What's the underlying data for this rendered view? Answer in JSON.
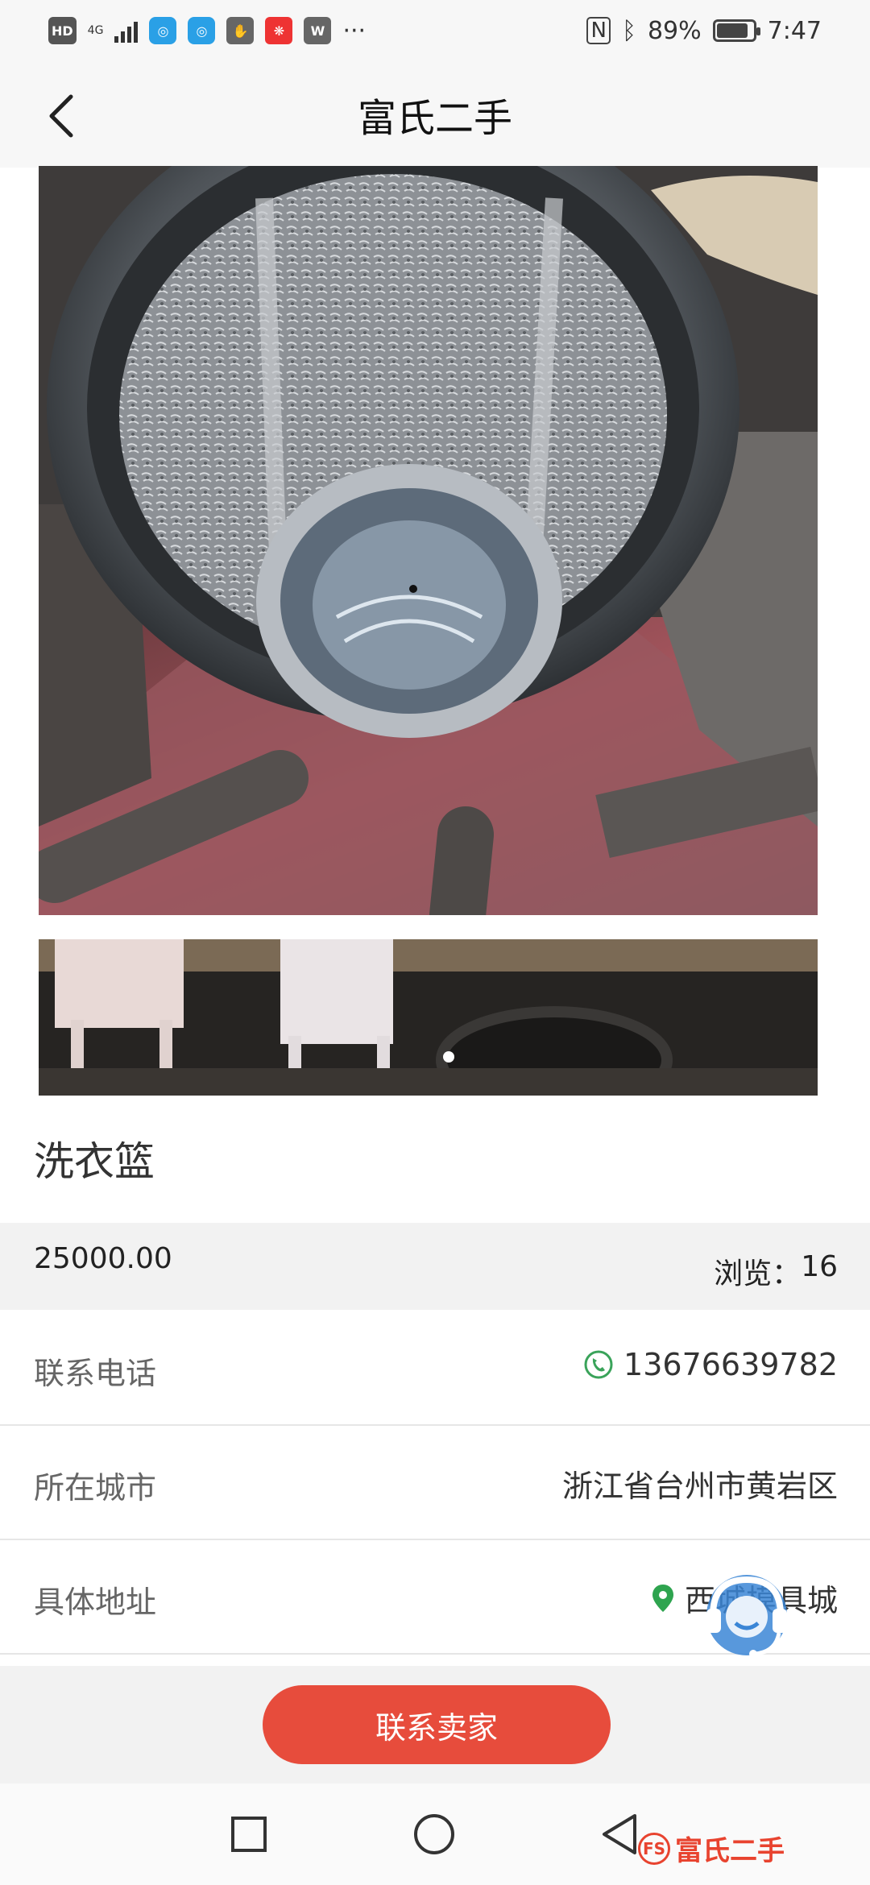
{
  "status_bar": {
    "hd": "HD",
    "net": "4G",
    "battery": "89%",
    "time": "7:47",
    "overflow": "···",
    "icons": [
      "hd-icon",
      "signal-icon",
      "app-icon",
      "app-icon",
      "hand-icon",
      "lucky-icon",
      "wps-icon",
      "nfc-icon",
      "bluetooth-icon",
      "battery-icon"
    ]
  },
  "header": {
    "title": "富氏二手",
    "back_icon": "chevron-left-icon"
  },
  "carousel": {
    "page_count": 1,
    "active_index": 0
  },
  "product": {
    "name": "洗衣篮"
  },
  "price_bar": {
    "price": "25000.00",
    "views_label": "浏览：",
    "views_count": "16"
  },
  "info": {
    "phone": {
      "label": "联系电话",
      "value": "13676639782",
      "icon": "phone-icon",
      "icon_color": "#3aa35a"
    },
    "city": {
      "label": "所在城市",
      "value": "浙江省台州市黄岩区"
    },
    "address": {
      "label": "具体地址",
      "value": "西城模具城",
      "icon": "location-pin-icon",
      "icon_color": "#2ea44f"
    }
  },
  "chat": {
    "label": "聊天",
    "color": "#6a9bf0"
  },
  "action": {
    "contact_label": "联系卖家",
    "color": "#e74c3c"
  },
  "watermark": {
    "text": "富氏二手",
    "logo": "FS",
    "color": "#e8432f"
  },
  "nav": {
    "recent": "square-icon",
    "home": "circle-icon",
    "back": "triangle-back-icon"
  }
}
